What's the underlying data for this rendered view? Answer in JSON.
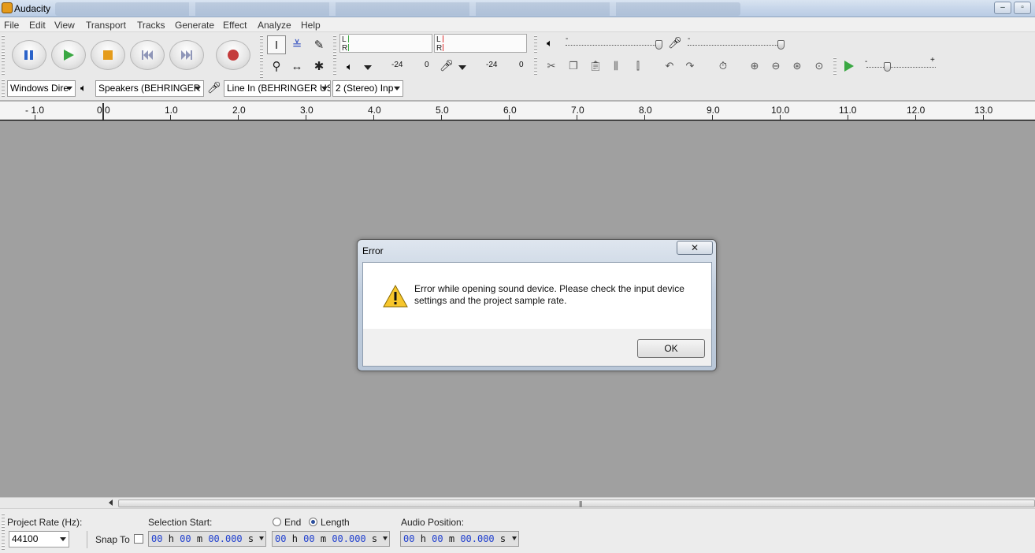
{
  "window": {
    "title": "Audacity",
    "minimize_label": "–",
    "maximize_label": "▫"
  },
  "menu": {
    "items": [
      "File",
      "Edit",
      "View",
      "Transport",
      "Tracks",
      "Generate",
      "Effect",
      "Analyze",
      "Help"
    ]
  },
  "meters": {
    "playback_left": "L",
    "playback_right": "R",
    "record_left": "L",
    "record_right": "R",
    "playback_scale": [
      "-24",
      "0"
    ],
    "record_scale": [
      "-24",
      "0"
    ]
  },
  "gain": {
    "minus": "-",
    "plus": "+"
  },
  "devices": {
    "host": "Windows Dire",
    "output": "Speakers (BEHRINGER U",
    "input": "Line In (BEHRINGER USI",
    "channels": "2 (Stereo) Inp"
  },
  "ruler": {
    "labels": [
      "- 1.0",
      "0.0",
      "1.0",
      "2.0",
      "3.0",
      "4.0",
      "5.0",
      "6.0",
      "7.0",
      "8.0",
      "9.0",
      "10.0",
      "11.0",
      "12.0",
      "13.0"
    ]
  },
  "selection_bar": {
    "project_rate_label": "Project Rate (Hz):",
    "project_rate_value": "44100",
    "snap_to_label": "Snap To",
    "selection_start_label": "Selection Start:",
    "end_label": "End",
    "length_label": "Length",
    "audio_position_label": "Audio Position:",
    "time_h": "00",
    "time_h_unit": "h",
    "time_m": "00",
    "time_m_unit": "m",
    "time_s": "00.000",
    "time_s_unit": "s"
  },
  "dialog": {
    "title": "Error",
    "close_label": "✕",
    "message": "Error while opening sound device. Please check the input device settings and the project sample rate.",
    "ok_label": "OK"
  },
  "colors": {
    "record_red": "#c43c3c",
    "play_green": "#3aa843",
    "pause_blue": "#2b63c9",
    "stop_orange": "#e59c1c"
  }
}
